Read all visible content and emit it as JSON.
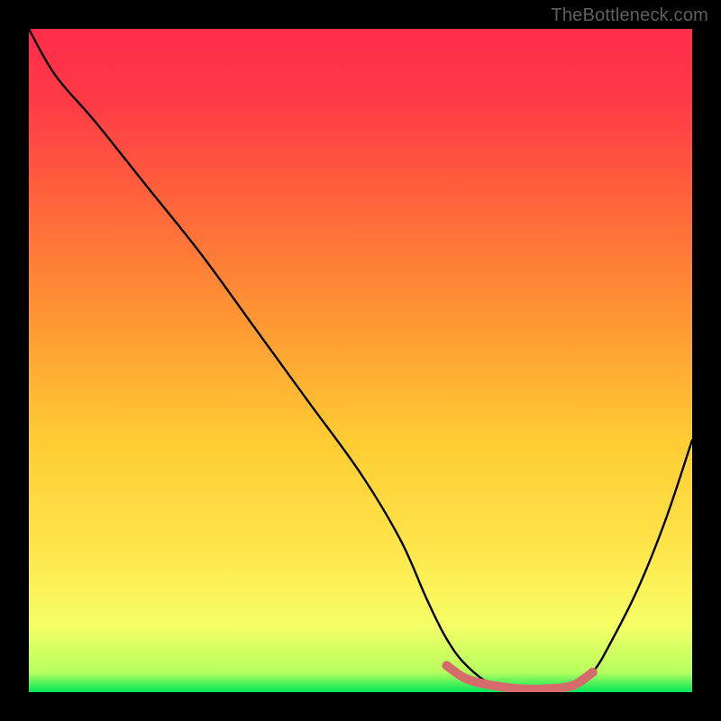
{
  "attribution": "TheBottleneck.com",
  "colors": {
    "gradient_top": "#ff2b4a",
    "gradient_mid": "#ffcc33",
    "gradient_bottom": "#00e858",
    "curve": "#000000",
    "marker": "#d66b6b",
    "background": "#000000"
  },
  "chart_data": {
    "type": "line",
    "title": "",
    "xlabel": "",
    "ylabel": "",
    "xlim": [
      0,
      100
    ],
    "ylim": [
      0,
      100
    ],
    "series": [
      {
        "name": "bottleneck-curve",
        "x": [
          0,
          4,
          10,
          18,
          26,
          34,
          42,
          50,
          56,
          60,
          63,
          66,
          70,
          74,
          78,
          82,
          85,
          88,
          92,
          96,
          100
        ],
        "y": [
          100,
          93,
          86,
          76,
          66,
          55,
          44,
          33,
          23,
          14,
          8,
          4,
          1,
          0,
          0,
          1,
          3,
          8,
          16,
          26,
          38
        ]
      }
    ],
    "markers": {
      "name": "highlight-band",
      "x": [
        63,
        66,
        70,
        74,
        78,
        82,
        85
      ],
      "y": [
        4,
        2,
        1,
        0.5,
        0.5,
        1,
        3
      ]
    }
  }
}
